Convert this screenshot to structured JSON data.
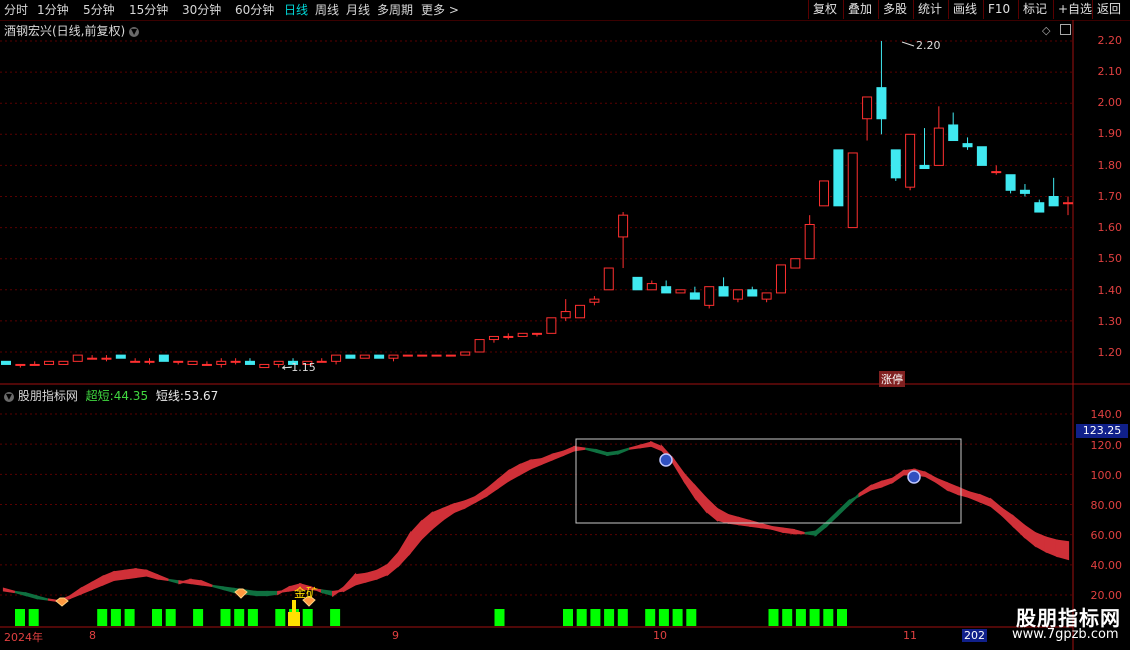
{
  "toolbar": {
    "periods": [
      "分时",
      "1分钟",
      "5分钟",
      "15分钟",
      "30分钟",
      "60分钟",
      "日线",
      "周线",
      "月线",
      "多周期",
      "更多 >"
    ],
    "active_period": "日线",
    "right_buttons": [
      "复权",
      "叠加",
      "多股",
      "统计",
      "画线",
      "F10",
      "标记",
      "+自选",
      "返回"
    ]
  },
  "upper_panel": {
    "title": "酒钢宏兴(日线,前复权)",
    "price_axis": [
      "2.20",
      "2.10",
      "2.00",
      "1.90",
      "1.80",
      "1.70",
      "1.60",
      "1.50",
      "1.40",
      "1.30",
      "1.20"
    ],
    "high_marker": "2.20",
    "low_marker": "1.15",
    "badge": "涨停"
  },
  "lower_panel": {
    "title": "股朋指标网",
    "super_short_label": "超短:",
    "super_short_value": "44.35",
    "short_label": "短线:",
    "short_value": "53.67",
    "axis": [
      "140.0",
      "120.0",
      "100.0",
      "80.00",
      "60.00",
      "40.00",
      "20.00"
    ],
    "current_value": "123.25",
    "signal_label": "金矿"
  },
  "x_axis": {
    "labels": [
      "2024年",
      "8",
      "9",
      "10",
      "11",
      "202"
    ]
  },
  "watermark": {
    "title": "股朋指标网",
    "url": "www.7gpzb.com"
  },
  "colors": {
    "up": "#ff3030",
    "down": "#40e8f0",
    "ribbon_up": "#d03038",
    "ribbon_down": "#0f7040",
    "signal_bar": "#00ff00",
    "yellow": "#ffe000",
    "axis": "#e04040"
  },
  "chart_data": {
    "type": "candlestick",
    "candles": [
      [
        1.17,
        1.17,
        1.16,
        1.16
      ],
      [
        1.16,
        1.16,
        1.15,
        1.16
      ],
      [
        1.16,
        1.17,
        1.16,
        1.16
      ],
      [
        1.16,
        1.17,
        1.16,
        1.17
      ],
      [
        1.16,
        1.17,
        1.16,
        1.17
      ],
      [
        1.17,
        1.19,
        1.17,
        1.19
      ],
      [
        1.18,
        1.19,
        1.18,
        1.18
      ],
      [
        1.18,
        1.19,
        1.17,
        1.18
      ],
      [
        1.19,
        1.19,
        1.18,
        1.18
      ],
      [
        1.17,
        1.18,
        1.17,
        1.17
      ],
      [
        1.17,
        1.18,
        1.16,
        1.17
      ],
      [
        1.19,
        1.19,
        1.17,
        1.17
      ],
      [
        1.17,
        1.17,
        1.16,
        1.17
      ],
      [
        1.16,
        1.17,
        1.16,
        1.17
      ],
      [
        1.16,
        1.17,
        1.16,
        1.16
      ],
      [
        1.16,
        1.18,
        1.15,
        1.17
      ],
      [
        1.17,
        1.18,
        1.16,
        1.17
      ],
      [
        1.17,
        1.18,
        1.16,
        1.16
      ],
      [
        1.15,
        1.16,
        1.15,
        1.16
      ],
      [
        1.16,
        1.17,
        1.15,
        1.17
      ],
      [
        1.17,
        1.18,
        1.16,
        1.16
      ],
      [
        1.16,
        1.17,
        1.16,
        1.17
      ],
      [
        1.17,
        1.18,
        1.17,
        1.17
      ],
      [
        1.17,
        1.18,
        1.16,
        1.19
      ],
      [
        1.19,
        1.19,
        1.18,
        1.18
      ],
      [
        1.18,
        1.19,
        1.18,
        1.19
      ],
      [
        1.19,
        1.19,
        1.18,
        1.18
      ],
      [
        1.18,
        1.19,
        1.17,
        1.19
      ],
      [
        1.19,
        1.19,
        1.19,
        1.19
      ],
      [
        1.19,
        1.19,
        1.19,
        1.19
      ],
      [
        1.19,
        1.19,
        1.19,
        1.19
      ],
      [
        1.19,
        1.19,
        1.19,
        1.19
      ],
      [
        1.19,
        1.2,
        1.19,
        1.2
      ],
      [
        1.2,
        1.24,
        1.2,
        1.24
      ],
      [
        1.24,
        1.25,
        1.23,
        1.25
      ],
      [
        1.25,
        1.26,
        1.24,
        1.25
      ],
      [
        1.25,
        1.26,
        1.25,
        1.26
      ],
      [
        1.26,
        1.26,
        1.25,
        1.26
      ],
      [
        1.26,
        1.31,
        1.26,
        1.31
      ],
      [
        1.31,
        1.37,
        1.3,
        1.33
      ],
      [
        1.31,
        1.35,
        1.31,
        1.35
      ],
      [
        1.36,
        1.38,
        1.35,
        1.37
      ],
      [
        1.4,
        1.47,
        1.4,
        1.47
      ],
      [
        1.57,
        1.65,
        1.47,
        1.64
      ],
      [
        1.44,
        1.44,
        1.4,
        1.4
      ],
      [
        1.4,
        1.43,
        1.41,
        1.42
      ],
      [
        1.41,
        1.43,
        1.4,
        1.39
      ],
      [
        1.39,
        1.4,
        1.39,
        1.4
      ],
      [
        1.39,
        1.41,
        1.38,
        1.37
      ],
      [
        1.35,
        1.41,
        1.34,
        1.41
      ],
      [
        1.41,
        1.44,
        1.38,
        1.38
      ],
      [
        1.37,
        1.4,
        1.36,
        1.4
      ],
      [
        1.4,
        1.41,
        1.38,
        1.38
      ],
      [
        1.37,
        1.39,
        1.36,
        1.39
      ],
      [
        1.39,
        1.48,
        1.39,
        1.48
      ],
      [
        1.47,
        1.5,
        1.47,
        1.5
      ],
      [
        1.5,
        1.64,
        1.5,
        1.61
      ],
      [
        1.67,
        1.75,
        1.67,
        1.75
      ],
      [
        1.85,
        1.85,
        1.67,
        1.67
      ],
      [
        1.6,
        1.84,
        1.6,
        1.84
      ],
      [
        1.95,
        2.02,
        1.88,
        2.02
      ],
      [
        2.05,
        2.2,
        1.9,
        1.95
      ],
      [
        1.85,
        1.83,
        1.75,
        1.76
      ],
      [
        1.73,
        1.9,
        1.72,
        1.9
      ],
      [
        1.8,
        1.92,
        1.8,
        1.79
      ],
      [
        1.8,
        1.99,
        1.81,
        1.92
      ],
      [
        1.93,
        1.97,
        1.88,
        1.88
      ],
      [
        1.87,
        1.89,
        1.85,
        1.86
      ],
      [
        1.86,
        1.86,
        1.8,
        1.8
      ],
      [
        1.78,
        1.8,
        1.77,
        1.78
      ],
      [
        1.77,
        1.77,
        1.71,
        1.72
      ],
      [
        1.72,
        1.74,
        1.7,
        1.71
      ],
      [
        1.68,
        1.69,
        1.65,
        1.65
      ],
      [
        1.7,
        1.76,
        1.68,
        1.67
      ],
      [
        1.68,
        1.7,
        1.64,
        1.68
      ]
    ],
    "super_short": [
      24,
      22,
      20,
      18,
      17,
      16,
      19,
      24,
      28,
      32,
      35,
      36,
      37,
      36,
      33,
      30,
      28,
      30,
      29,
      26,
      24,
      22,
      21,
      20,
      20,
      21,
      25,
      27,
      25,
      22,
      20,
      25,
      33,
      34,
      36,
      40,
      48,
      60,
      68,
      74,
      77,
      80,
      82,
      85,
      90,
      96,
      102,
      106,
      109,
      110,
      113,
      115,
      118,
      117,
      115,
      113,
      114,
      117,
      119,
      121,
      118,
      110,
      100,
      92,
      84,
      77,
      73,
      71,
      69,
      67,
      65,
      64,
      63,
      61,
      60,
      66,
      73,
      80,
      87,
      92,
      95,
      97,
      102,
      103,
      101,
      97,
      94,
      91,
      88,
      86,
      83,
      77,
      72,
      66,
      61,
      58,
      56,
      55
    ],
    "short": [
      23,
      22,
      21,
      19,
      17,
      16,
      18,
      21,
      24,
      27,
      30,
      31,
      32,
      33,
      31,
      30,
      29,
      28,
      27,
      26,
      25,
      24,
      23,
      22,
      22,
      22,
      23,
      24,
      24,
      23,
      22,
      23,
      27,
      29,
      31,
      34,
      40,
      48,
      57,
      64,
      70,
      75,
      78,
      82,
      86,
      91,
      96,
      100,
      104,
      107,
      110,
      113,
      116,
      117,
      116,
      114,
      115,
      117,
      118,
      119,
      116,
      108,
      96,
      85,
      76,
      70,
      68,
      67,
      66,
      65,
      64,
      62,
      61,
      61,
      62,
      68,
      75,
      82,
      86,
      90,
      92,
      95,
      100,
      100,
      99,
      95,
      90,
      87,
      85,
      82,
      79,
      73,
      66,
      59,
      53,
      49,
      46,
      44
    ],
    "signal_days": [
      0,
      1,
      6,
      7,
      8,
      10,
      11,
      13,
      15,
      16,
      17,
      19,
      20,
      21,
      23,
      35,
      40,
      41,
      42,
      43,
      44,
      46,
      47,
      48,
      49,
      55,
      56,
      57,
      58,
      59,
      60
    ],
    "price_axis_range": [
      1.15,
      2.25
    ],
    "indicator_axis_range": [
      15,
      150
    ]
  }
}
